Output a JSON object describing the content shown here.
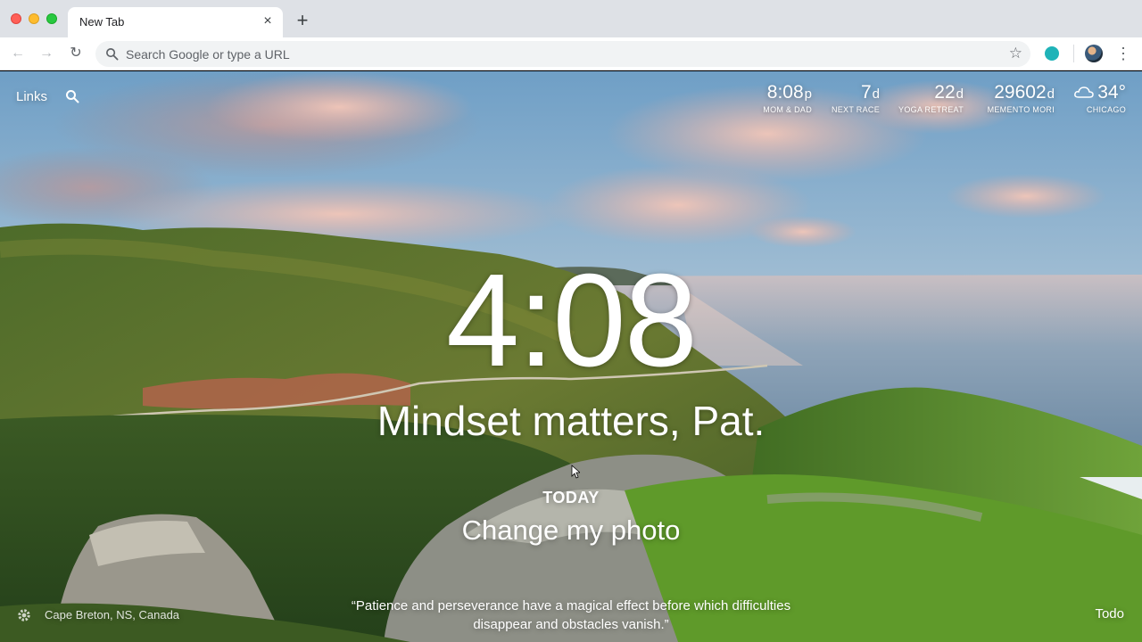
{
  "browser": {
    "tab_title": "New Tab",
    "tab_close_glyph": "×",
    "new_tab_glyph": "+",
    "omnibox_placeholder": "Search Google or type a URL",
    "back_glyph": "←",
    "forward_glyph": "→",
    "reload_glyph": "↻",
    "star_glyph": "☆",
    "menu_glyph": "⋮",
    "extension_color": "#1fb3b8"
  },
  "dashboard": {
    "links_label": "Links",
    "metrics": [
      {
        "value": "8:08",
        "unit": "p",
        "label": "MOM & DAD"
      },
      {
        "value": "7",
        "unit": "d",
        "label": "NEXT RACE"
      },
      {
        "value": "22",
        "unit": "d",
        "label": "YOGA RETREAT"
      },
      {
        "value": "29602",
        "unit": "d",
        "label": "MEMENTO MORI"
      }
    ],
    "weather": {
      "temp": "34°",
      "label": "CHICAGO",
      "icon": "cloud-icon"
    },
    "clock": "4:08",
    "greeting": "Mindset matters, Pat.",
    "focus_label": "TODAY",
    "focus_text": "Change my photo",
    "quote": "“Patience and perseverance have a magical effect before which difficulties disappear and obstacles vanish.”",
    "location": "Cape Breton, NS, Canada",
    "todo_label": "Todo"
  }
}
